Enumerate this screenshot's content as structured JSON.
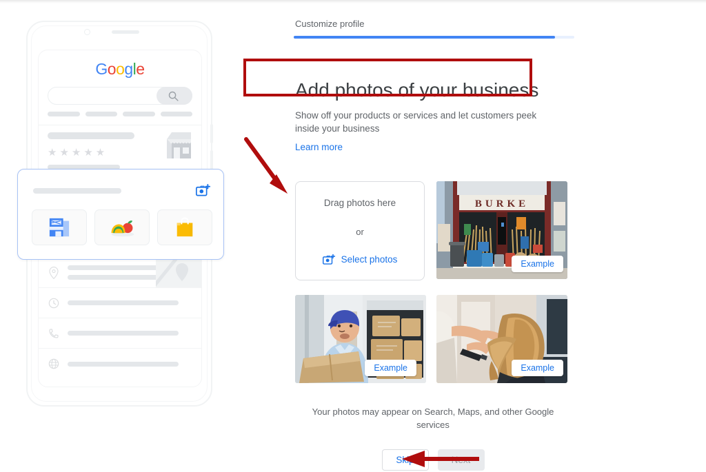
{
  "step": {
    "label": "Customize profile",
    "progress_percent": 93,
    "accent_color": "#4285F4",
    "track_color": "#e8f0fe"
  },
  "page": {
    "title": "Add photos of your business",
    "subtitle": "Show off your products or services and let customers peek inside your business",
    "learn_more": "Learn more",
    "footnote": "Your photos may appear on Search, Maps, and other Google services"
  },
  "dropzone": {
    "drag_text": "Drag photos here",
    "or_text": "or",
    "select_label": "Select photos",
    "select_icon": "camera-plus-icon",
    "link_color": "#1a73e8"
  },
  "examples": [
    {
      "badge": "Example",
      "caption": "storefront-hardware-store-burke"
    },
    {
      "badge": "Example",
      "caption": "delivery-worker-with-boxes"
    },
    {
      "badge": "Example",
      "caption": "hair-salon-stylist"
    }
  ],
  "buttons": {
    "skip": "Skip",
    "next": "Next",
    "next_disabled": true
  },
  "phone_preview": {
    "logo_letters": [
      {
        "char": "G",
        "color": "#4285F4"
      },
      {
        "char": "o",
        "color": "#EA4335"
      },
      {
        "char": "o",
        "color": "#FBBC05"
      },
      {
        "char": "g",
        "color": "#4285F4"
      },
      {
        "char": "l",
        "color": "#34A853"
      },
      {
        "char": "e",
        "color": "#EA4335"
      }
    ],
    "search_icon": "search-icon",
    "rating_stars": 5,
    "store_icon": "storefront-icon",
    "card": {
      "camera_icon": "camera-plus-icon",
      "tiles": [
        "storefront-tile-icon",
        "food-tile-icon",
        "shopping-bag-tile-icon"
      ]
    },
    "info_rows": [
      {
        "icon": "location-pin-icon"
      },
      {
        "icon": "clock-icon"
      },
      {
        "icon": "phone-icon"
      },
      {
        "icon": "globe-icon"
      }
    ]
  },
  "annotations": {
    "title_box_color": "#b00d0d",
    "arrow_color": "#b00d0d",
    "arrow_to_dropzone": "diagonal-arrow-pointing-to-dropzone",
    "arrow_to_next": "horizontal-arrow-pointing-to-next-button"
  }
}
